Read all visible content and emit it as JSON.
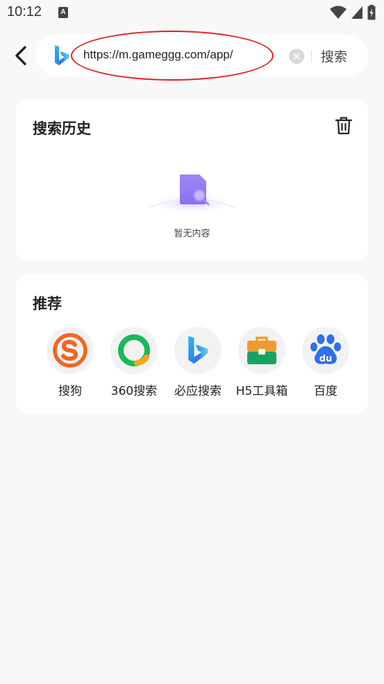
{
  "status_bar": {
    "time": "10:12",
    "notification_letter": "A",
    "icons": [
      "wifi-icon",
      "signal-icon",
      "battery-icon"
    ]
  },
  "search_bar": {
    "engine_icon": "bing-icon",
    "url": "https://m.gameggg.com/app/",
    "clear_icon": "clear-icon",
    "search_label": "搜索",
    "highlight_color": "#e02020"
  },
  "history": {
    "title": "搜索历史",
    "delete_icon": "trash-icon",
    "empty_text": "暂无内容"
  },
  "recommend": {
    "title": "推荐",
    "items": [
      {
        "label": "搜狗",
        "icon": "sogou-icon",
        "color": "#f26522"
      },
      {
        "label": "360搜索",
        "icon": "360-search-icon",
        "color": "#19b955"
      },
      {
        "label": "必应搜索",
        "icon": "bing-icon",
        "color": "#2f7bf5"
      },
      {
        "label": "H5工具箱",
        "icon": "toolbox-icon",
        "color": "#1aa260"
      },
      {
        "label": "百度",
        "icon": "baidu-icon",
        "color": "#2f6fe8"
      }
    ]
  }
}
